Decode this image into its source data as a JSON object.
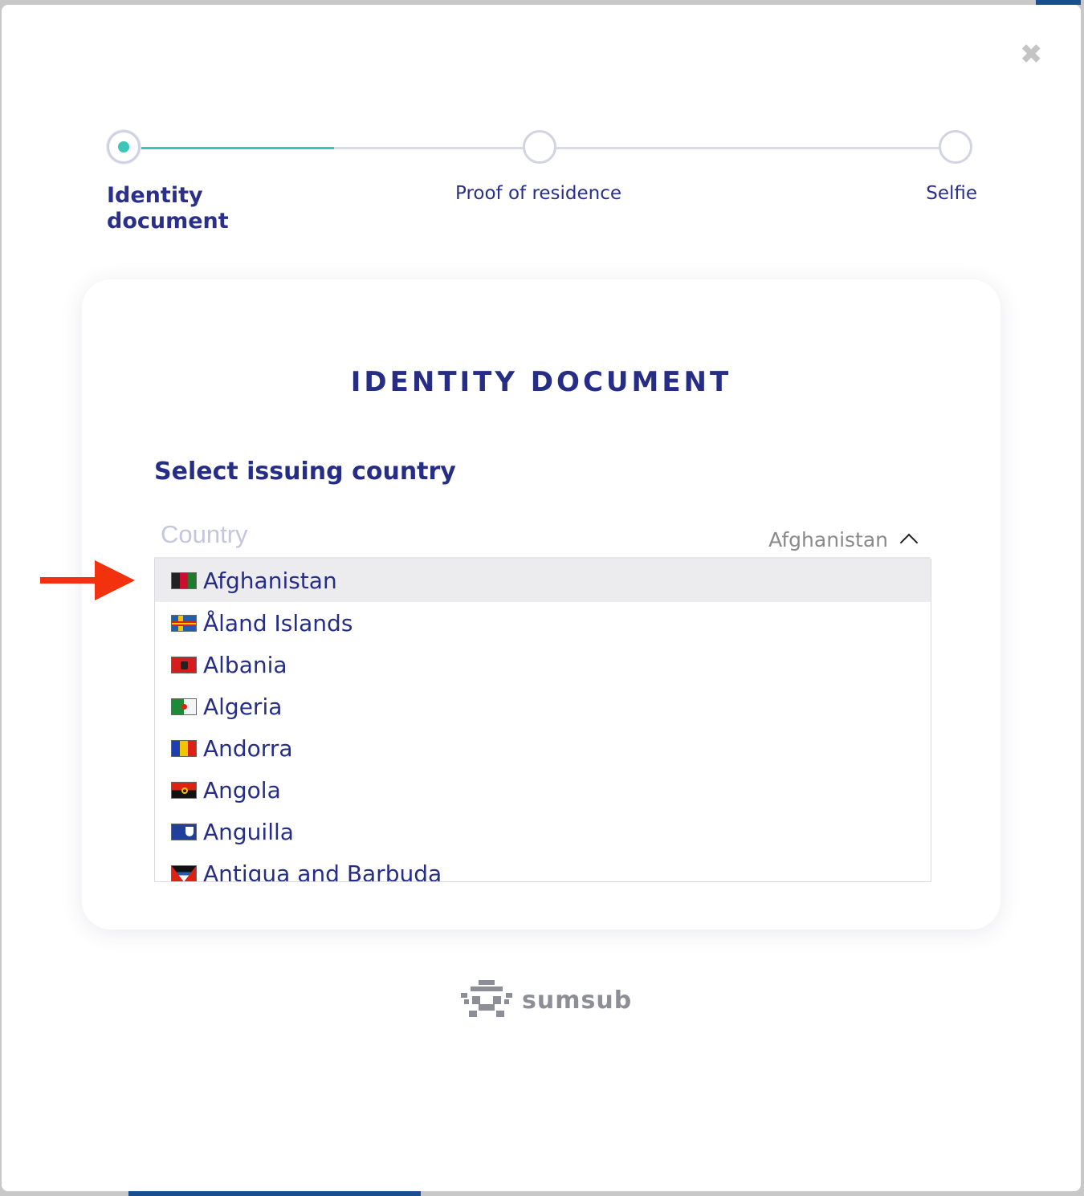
{
  "close": {
    "icon": "close-icon",
    "glyph": "✖"
  },
  "stepper": {
    "progress": 0.25,
    "steps": [
      {
        "label": "Identity document",
        "active": true
      },
      {
        "label": "Proof of residence",
        "active": false
      },
      {
        "label": "Selfie",
        "active": false
      }
    ]
  },
  "card": {
    "title": "IDENTITY DOCUMENT",
    "section_title": "Select issuing country",
    "select": {
      "placeholder": "Country",
      "value": "Afghanistan",
      "expanded": true,
      "chevron_icon": "chevron-up-icon"
    },
    "options": [
      {
        "label": "Afghanistan",
        "flag": "af",
        "selected": true
      },
      {
        "label": "Åland Islands",
        "flag": "ax",
        "selected": false
      },
      {
        "label": "Albania",
        "flag": "al",
        "selected": false
      },
      {
        "label": "Algeria",
        "flag": "dz",
        "selected": false
      },
      {
        "label": "Andorra",
        "flag": "ad",
        "selected": false
      },
      {
        "label": "Angola",
        "flag": "ao",
        "selected": false
      },
      {
        "label": "Anguilla",
        "flag": "ai",
        "selected": false
      },
      {
        "label": "Antigua and Barbuda",
        "flag": "ag",
        "selected": false
      }
    ]
  },
  "annotation": {
    "icon": "arrow-right-icon",
    "color": "#f2320e"
  },
  "brand": {
    "name": "sumsub",
    "icon": "sumsub-logo-icon"
  },
  "colors": {
    "accent": "#3cc6b9",
    "primary_text": "#262d86",
    "muted": "#8d8f97"
  }
}
